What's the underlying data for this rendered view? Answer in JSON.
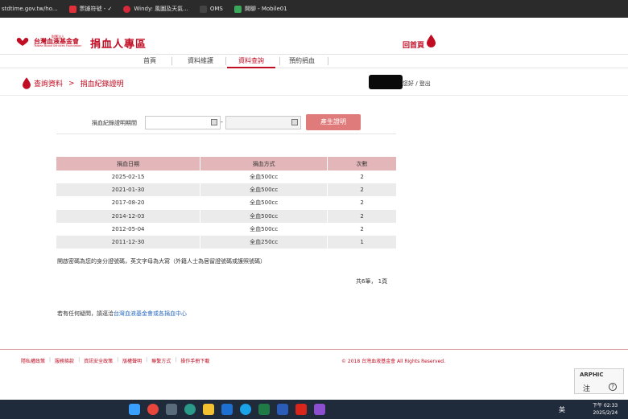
{
  "bookmarks": [
    {
      "label": "stdtime.gov.tw/ho...",
      "icon": "globe-icon",
      "color": "#2b2b2b"
    },
    {
      "label": "票據符號 - ✓",
      "icon": "bookmark-icon",
      "color": "#e0303a"
    },
    {
      "label": "Windy: 風圖及天氣...",
      "icon": "windy-icon",
      "color": "#d8283a"
    },
    {
      "label": "OMS",
      "icon": "oms-icon",
      "color": "#444444"
    },
    {
      "label": "開聊 - Mobile01",
      "icon": "mobile01-icon",
      "color": "#3aa85a"
    }
  ],
  "header": {
    "logo_sub": "財團法人",
    "logo_cn": "台灣血液基金會",
    "logo_en": "Taiwan Blood Services Foundation",
    "site_title": "捐血人專區",
    "home_link": "回首頁",
    "brand_color": "#c00d23"
  },
  "nav": {
    "items": [
      {
        "label": "首頁",
        "active": false
      },
      {
        "label": "資料維護",
        "active": false
      },
      {
        "label": "資料查詢",
        "active": true
      },
      {
        "label": "預約捐血",
        "active": false
      }
    ]
  },
  "breadcrumb": {
    "root": "查詢資料",
    "separator": ">",
    "current": "捐血紀錄證明"
  },
  "user": {
    "greeting": "您好 / 登出"
  },
  "form": {
    "label": "捐血紀錄證明期間",
    "start_value": "",
    "end_value": "",
    "range_separator": "-",
    "generate_button": "產生證明",
    "button_color": "#e07b7b"
  },
  "table": {
    "headers": [
      "捐血日期",
      "捐血方式",
      "次數"
    ],
    "rows": [
      [
        "2025-02-15",
        "全血500cc",
        "2"
      ],
      [
        "2021-01-30",
        "全血500cc",
        "2"
      ],
      [
        "2017-08-20",
        "全血500cc",
        "2"
      ],
      [
        "2014-12-03",
        "全血500cc",
        "2"
      ],
      [
        "2012-05-04",
        "全血500cc",
        "2"
      ],
      [
        "2011-12-30",
        "全血250cc",
        "1"
      ]
    ],
    "header_color": "#e3b7b9"
  },
  "note": "開啟密碼為您的身分證號碼，英文字母為大寫（外籍人士為居留證號碼或護照號碼）",
  "pager": "共6筆， 1頁",
  "contact": {
    "prefix": "若有任何疑問，請逕洽",
    "link": "台灣血液基金會或各捐血中心"
  },
  "footer": {
    "links": [
      "隱私權政策",
      "服務條款",
      "資訊安全政策",
      "版權聲明",
      "聯繫方式",
      "操作手冊下載"
    ],
    "copyright": "© 2018 台灣血液基金會 All Rights Reserved."
  },
  "ime": {
    "brand": "ARPHIC",
    "mode": "注",
    "help": "?"
  },
  "taskbar": {
    "apps": [
      {
        "name": "windows-start-icon",
        "color": "#3aa0ff"
      },
      {
        "name": "chrome-icon",
        "color": "#e8453c"
      },
      {
        "name": "calculator-icon",
        "color": "#5a6b7c"
      },
      {
        "name": "edge-icon",
        "color": "#2a9a8a"
      },
      {
        "name": "file-explorer-icon",
        "color": "#f2c230"
      },
      {
        "name": "outlook-icon",
        "color": "#1d6fd0"
      },
      {
        "name": "skype-icon",
        "color": "#1aa3e8"
      },
      {
        "name": "excel-icon",
        "color": "#1f7a45"
      },
      {
        "name": "word-icon",
        "color": "#2b5cb8"
      },
      {
        "name": "acrobat-icon",
        "color": "#d8261c"
      },
      {
        "name": "purple-app-icon",
        "color": "#8c4fd0"
      }
    ],
    "input_lang": "英",
    "time": "下午 02:33",
    "date": "2025/2/24"
  }
}
